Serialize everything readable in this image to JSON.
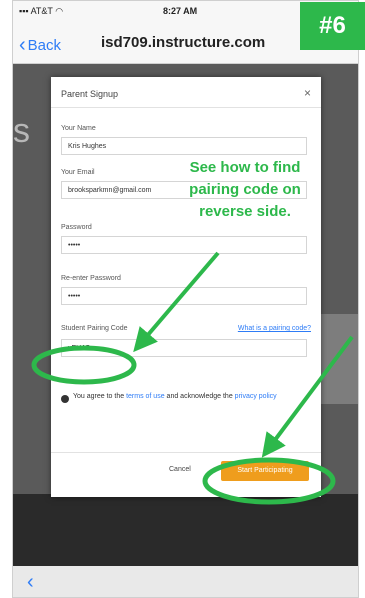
{
  "status_bar": {
    "carrier": "AT&T",
    "time": "8:27 AM"
  },
  "nav": {
    "back_label": "Back",
    "url": "isd709.instructure.com"
  },
  "badge": "#6",
  "modal": {
    "title": "Parent Signup",
    "fields": {
      "name": {
        "label": "Your Name",
        "value": "Kris Hughes"
      },
      "email": {
        "label": "Your Email",
        "value": "brooksparkmn@gmail.com"
      },
      "password": {
        "label": "Password",
        "value": "•••••"
      },
      "reenter": {
        "label": "Re-enter Password",
        "value": "•••••"
      },
      "pairing": {
        "label": "Student Pairing Code",
        "value": "vEHA5",
        "help_link": "What is a pairing code?"
      }
    },
    "agree": {
      "prefix": "You agree to the",
      "terms": "terms of use",
      "middle": "and acknowledge the",
      "privacy": "privacy policy"
    },
    "buttons": {
      "cancel": "Cancel",
      "start": "Start Participating"
    }
  },
  "annotation": {
    "line1": "See how to find",
    "line2": "pairing code on",
    "line3": "reverse side."
  },
  "colors": {
    "annotation_green": "#2db84b",
    "start_button": "#ef9d1d",
    "link": "#2e7cf6"
  }
}
